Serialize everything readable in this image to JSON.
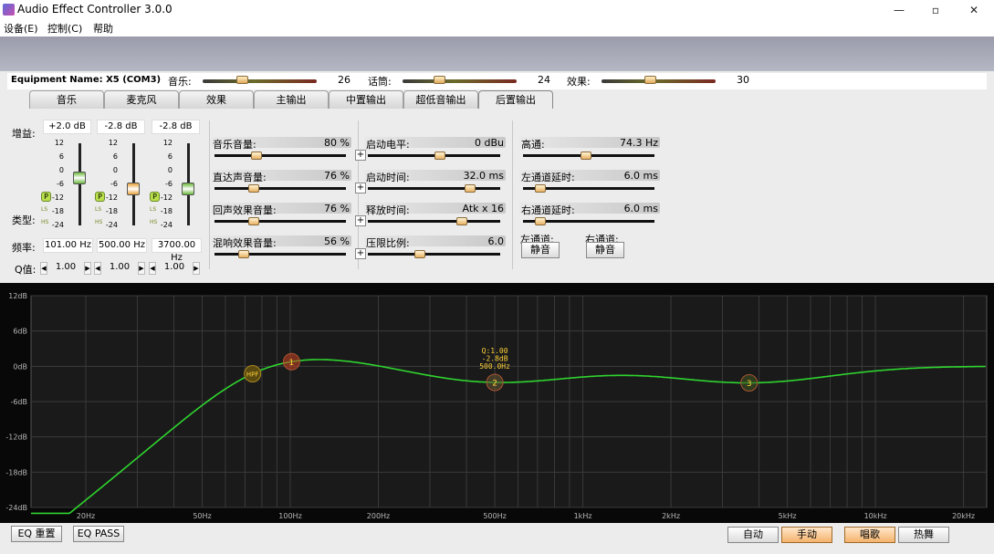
{
  "window": {
    "title": "Audio Effect Controller 3.0.0",
    "min": "—",
    "max": "▫",
    "close": "✕"
  },
  "menu": [
    "设备(E)",
    "控制(C)",
    "帮助"
  ],
  "equipment": {
    "label": "Equipment Name: X5 (COM3)",
    "sliders": [
      {
        "label": "音乐:",
        "value": "26",
        "pos": 0.33
      },
      {
        "label": "话筒:",
        "value": "24",
        "pos": 0.3
      },
      {
        "label": "效果:",
        "value": "30",
        "pos": 0.42
      }
    ]
  },
  "tabs": [
    "音乐",
    "麦克风",
    "效果",
    "主输出",
    "中置输出",
    "超低音输出",
    "后置输出"
  ],
  "active_tab": 6,
  "eq_bands": {
    "gain_label": "增益:",
    "type_label": "类型:",
    "freq_label": "频率:",
    "q_label": "Q值:",
    "bands": [
      {
        "gain": "+2.0 dB",
        "freq": "101.00 Hz",
        "q": "1.00",
        "level": 0.58,
        "color": "#6ab83a"
      },
      {
        "gain": "-2.8 dB",
        "freq": "500.00 Hz",
        "q": "1.00",
        "level": 0.44,
        "color": "#e8a23a"
      },
      {
        "gain": "-2.8 dB",
        "freq": "3700.00 Hz",
        "q": "1.00",
        "level": 0.44,
        "color": "#6ab83a"
      }
    ],
    "scale": [
      "12",
      "6",
      "0",
      "-6",
      "-12",
      "-18",
      "-24"
    ],
    "type_btn": "P",
    "ls": "LS",
    "hs": "HS"
  },
  "params_a": [
    {
      "label": "音乐音量:",
      "value": "80 %",
      "pos": 0.3
    },
    {
      "label": "直达声音量:",
      "value": "76 %",
      "pos": 0.28
    },
    {
      "label": "回声效果音量:",
      "value": "76 %",
      "pos": 0.28
    },
    {
      "label": "混响效果音量:",
      "value": "56 %",
      "pos": 0.2
    }
  ],
  "params_b": [
    {
      "label": "启动电平:",
      "value": "0 dBu",
      "pos": 0.55
    },
    {
      "label": "启动时间:",
      "value": "32.0 ms",
      "pos": 0.8
    },
    {
      "label": "释放时间:",
      "value": "Atk x 16",
      "pos": 0.73
    },
    {
      "label": "压限比例:",
      "value": "6.0",
      "pos": 0.38
    }
  ],
  "params_c": [
    {
      "label": "高通:",
      "value": "74.3 Hz",
      "pos": 0.48
    },
    {
      "label": "左通道延时:",
      "value": "6.0 ms",
      "pos": 0.1
    },
    {
      "label": "右通道延时:",
      "value": "6.0 ms",
      "pos": 0.1
    }
  ],
  "channels": {
    "left_label": "左通道:",
    "right_label": "右通道:",
    "mute": "静音"
  },
  "graph": {
    "y_labels": [
      "12dB",
      "6dB",
      "0dB",
      "-6dB",
      "-12dB",
      "-18dB",
      "-24dB"
    ],
    "x_labels": [
      "20Hz",
      "50Hz",
      "100Hz",
      "200Hz",
      "500Hz",
      "1kHz",
      "2kHz",
      "5kHz",
      "10kHz",
      "20kHz"
    ],
    "x_freqs": [
      20,
      50,
      100,
      200,
      500,
      1000,
      2000,
      5000,
      10000,
      20000
    ],
    "hpf_label": "HPF",
    "node1": "1",
    "node2": "2",
    "node3": "3",
    "info": [
      "Q:1.00",
      "-2.8dB",
      "500.0Hz"
    ],
    "curve_color": "#2fd52f"
  },
  "bottom": {
    "eq_reset": "EQ 重置",
    "eq_pass": "EQ PASS",
    "auto": "自动",
    "manual": "手动",
    "sing": "唱歌",
    "dance": "热舞"
  }
}
